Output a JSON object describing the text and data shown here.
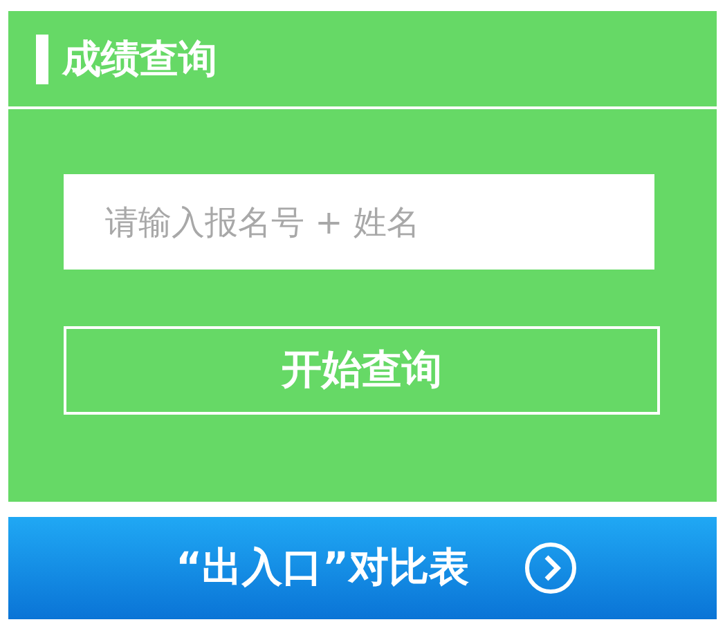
{
  "panel": {
    "title": "成绩查询"
  },
  "search": {
    "placeholder": "请输入报名号 + 姓名"
  },
  "submit": {
    "label": "开始查询"
  },
  "banner": {
    "label": "“出入口”对比表"
  }
}
